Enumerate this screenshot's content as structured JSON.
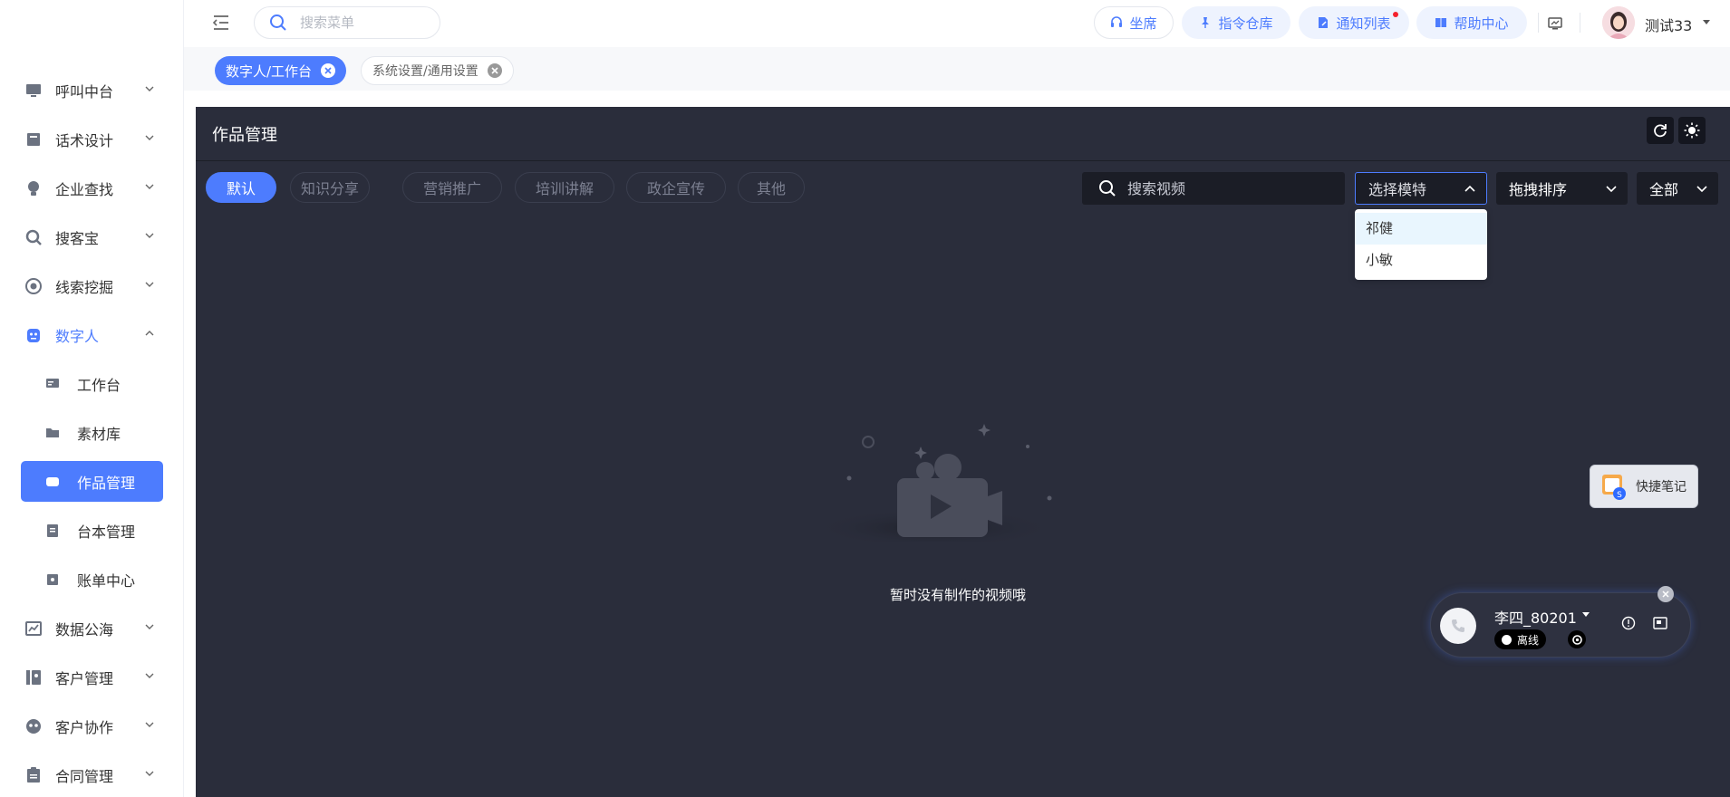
{
  "sidebar": {
    "items": [
      {
        "label": "呼叫中台",
        "icon": "monitor-icon"
      },
      {
        "label": "话术设计",
        "icon": "book-icon"
      },
      {
        "label": "企业查找",
        "icon": "bulb-icon"
      },
      {
        "label": "搜客宝",
        "icon": "search-zoom-icon"
      },
      {
        "label": "线索挖掘",
        "icon": "target-icon"
      },
      {
        "label": "数字人",
        "icon": "robot-icon"
      },
      {
        "label": "数据公海",
        "icon": "chart-icon"
      },
      {
        "label": "客户管理",
        "icon": "contacts-icon"
      },
      {
        "label": "客户协作",
        "icon": "team-icon"
      },
      {
        "label": "合同管理",
        "icon": "clipboard-icon"
      }
    ],
    "sub_items": [
      {
        "label": "工作台",
        "icon": "workbench-icon"
      },
      {
        "label": "素材库",
        "icon": "folder-icon"
      },
      {
        "label": "作品管理",
        "icon": "video-icon"
      },
      {
        "label": "台本管理",
        "icon": "script-icon"
      },
      {
        "label": "账单中心",
        "icon": "bill-icon"
      }
    ]
  },
  "header": {
    "search_placeholder": "搜索菜单",
    "seat": "坐席",
    "commands": "指令仓库",
    "notifications": "通知列表",
    "help": "帮助中心",
    "username": "测试33"
  },
  "tabs": [
    {
      "label": "数字人/工作台",
      "active": true
    },
    {
      "label": "系统设置/通用设置",
      "active": false
    }
  ],
  "main": {
    "title": "作品管理",
    "categories": [
      "默认",
      "知识分享",
      "营销推广",
      "培训讲解",
      "政企宣传",
      "其他"
    ],
    "video_search_placeholder": "搜索视频",
    "model_select": "选择模特",
    "sort_select": "拖拽排序",
    "filter_select": "全部",
    "model_options": [
      "祁健",
      "小敏"
    ],
    "empty_text": "暂时没有制作的视频哦"
  },
  "quick_note": "快捷笔记",
  "call_widget": {
    "agent": "李四_80201",
    "status": "离线"
  },
  "colors": {
    "accent": "#4d7cfe",
    "main_bg": "#2a2d3b",
    "input_bg": "#1b1d26"
  }
}
